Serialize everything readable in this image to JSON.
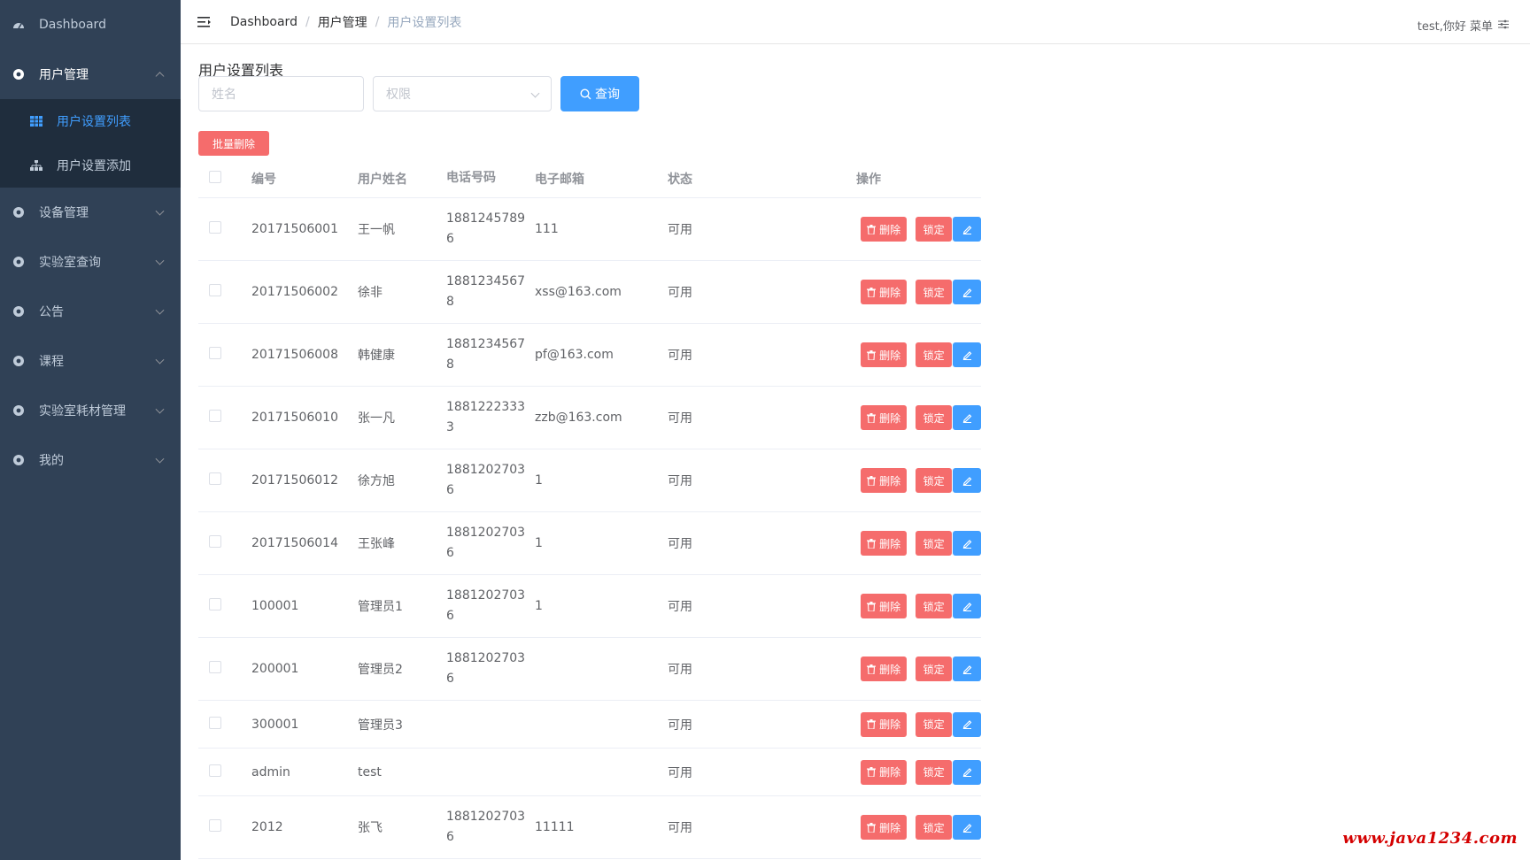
{
  "sidebar": {
    "dashboard": "Dashboard",
    "user_mgmt": "用户管理",
    "sub_items": [
      "用户设置列表",
      "用户设置添加"
    ],
    "groups": [
      "设备管理",
      "实验室查询",
      "公告",
      "课程",
      "实验室耗材管理",
      "我的"
    ]
  },
  "header": {
    "breadcrumb": [
      "Dashboard",
      "用户管理",
      "用户设置列表"
    ],
    "breadcrumb_sep": "/",
    "greeting": "test,你好 菜单"
  },
  "main": {
    "title": "用户设置列表",
    "name_placeholder": "姓名",
    "role_placeholder": "权限",
    "search_label": "查询",
    "batch_delete_label": "批量删除"
  },
  "table": {
    "headers": [
      "编号",
      "用户姓名",
      "电话号码",
      "电子邮箱",
      "状态",
      "操作"
    ],
    "delete_label": "删除",
    "lock_label": "锁定",
    "rows": [
      {
        "id": "20171506001",
        "name": "王一帆",
        "phone": "18812457896",
        "email": "111",
        "status": "可用"
      },
      {
        "id": "20171506002",
        "name": "徐非",
        "phone": "18812345678",
        "email": "xss@163.com",
        "status": "可用"
      },
      {
        "id": "20171506008",
        "name": "韩健康",
        "phone": "18812345678",
        "email": "pf@163.com",
        "status": "可用"
      },
      {
        "id": "20171506010",
        "name": "张一凡",
        "phone": "18812223333",
        "email": "zzb@163.com",
        "status": "可用"
      },
      {
        "id": "20171506012",
        "name": "徐方旭",
        "phone": "18812027036",
        "email": "1",
        "status": "可用"
      },
      {
        "id": "20171506014",
        "name": "王张峰",
        "phone": "18812027036",
        "email": "1",
        "status": "可用"
      },
      {
        "id": "100001",
        "name": "管理员1",
        "phone": "18812027036",
        "email": "1",
        "status": "可用"
      },
      {
        "id": "200001",
        "name": "管理员2",
        "phone": "18812027036",
        "email": "",
        "status": "可用"
      },
      {
        "id": "300001",
        "name": "管理员3",
        "phone": "",
        "email": "",
        "status": "可用"
      },
      {
        "id": "admin",
        "name": "test",
        "phone": "",
        "email": "",
        "status": "可用"
      },
      {
        "id": "2012",
        "name": "张飞",
        "phone": "18812027036",
        "email": "11111",
        "status": "可用"
      }
    ]
  },
  "watermark": "www.java1234.com",
  "colors": {
    "sidebar_bg": "#304156",
    "submenu_bg": "#1f2d3d",
    "primary": "#409eff",
    "danger": "#f56c6c",
    "watermark": "#d40000"
  }
}
